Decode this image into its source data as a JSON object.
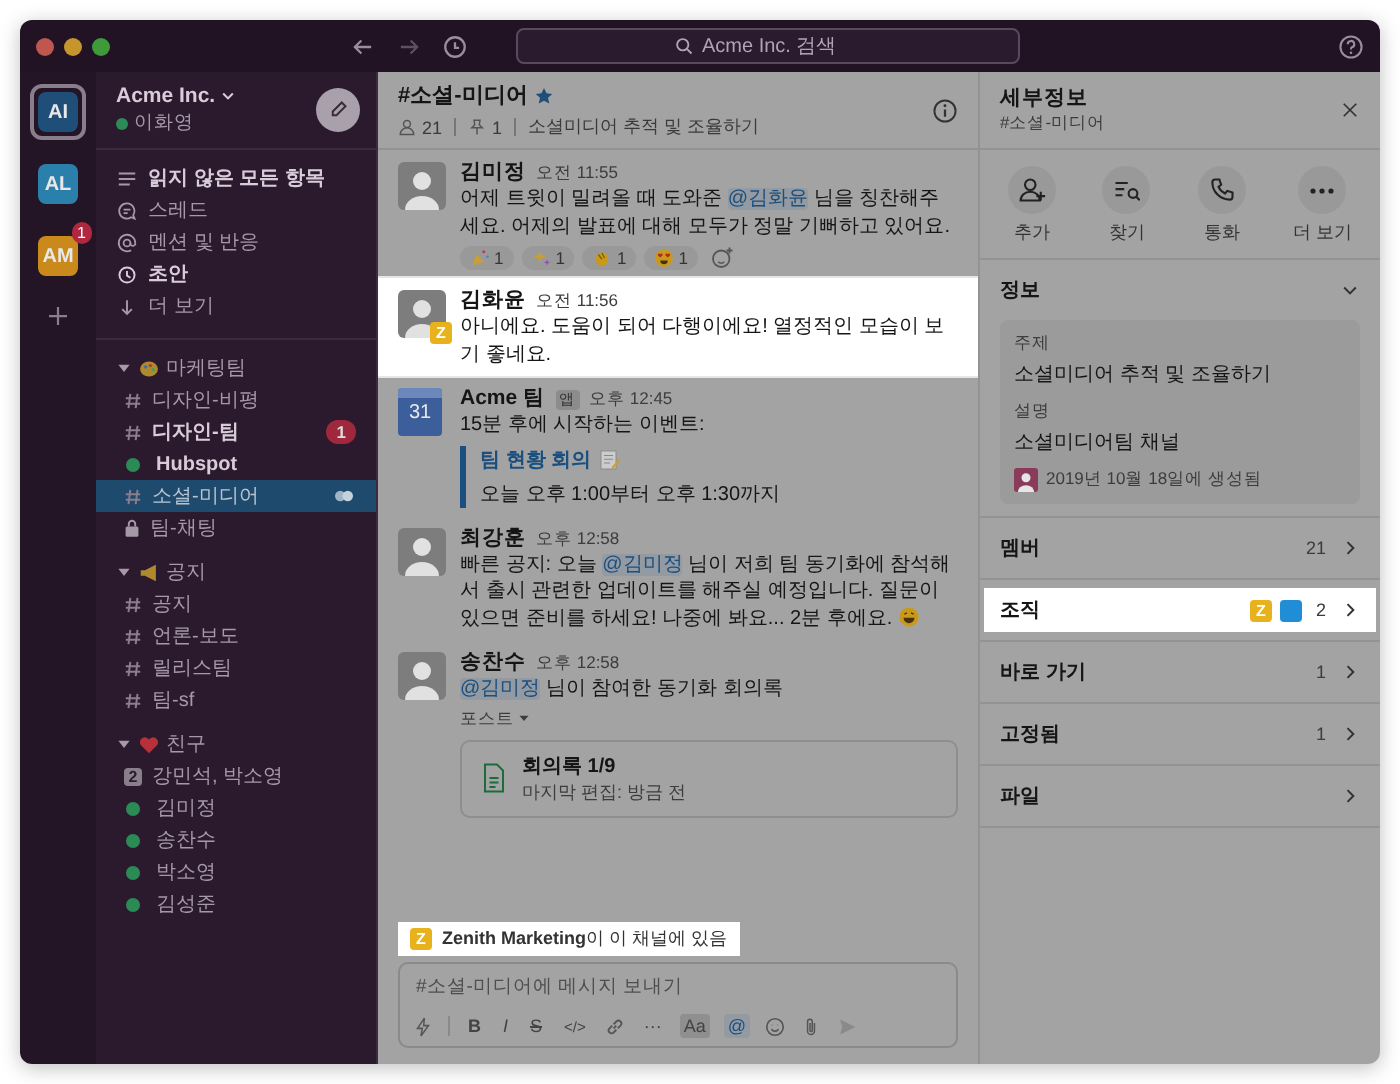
{
  "titlebar": {
    "search": {
      "placeholder": "Acme Inc. 검색"
    }
  },
  "workspaces": [
    {
      "initials": "AI",
      "color": "#1f4e79",
      "selected": true
    },
    {
      "initials": "AL",
      "color": "#2b7fab",
      "selected": false
    },
    {
      "initials": "AM",
      "color": "#c98a1b",
      "selected": false,
      "badge": "1"
    }
  ],
  "sidebar": {
    "workspace": "Acme Inc.",
    "user": "이화영",
    "nav": [
      {
        "kind": "unread",
        "label": "읽지 않은 모든 항목",
        "bold": true
      },
      {
        "kind": "threads",
        "label": "스레드",
        "bold": false
      },
      {
        "kind": "mentions",
        "label": "멘션 및 반응",
        "bold": false
      },
      {
        "kind": "drafts",
        "label": "초안",
        "bold": true
      },
      {
        "kind": "more",
        "label": "더 보기",
        "bold": false
      }
    ],
    "sections": [
      {
        "kind": "palette",
        "title": "마케팅팀",
        "expanded": true,
        "items": [
          {
            "kind": "channel",
            "label": "디자인-비평",
            "bold": false,
            "selected": false
          },
          {
            "kind": "channel",
            "label": "디자인-팀",
            "bold": true,
            "selected": false,
            "badge": "1"
          },
          {
            "kind": "app",
            "label": "Hubspot",
            "bold": true,
            "selected": false
          },
          {
            "kind": "channel",
            "label": "소셜-미디어",
            "bold": false,
            "selected": true,
            "shared": true
          },
          {
            "kind": "private",
            "label": "팀-채팅",
            "bold": false,
            "selected": false
          }
        ]
      },
      {
        "kind": "megaphone",
        "title": "공지",
        "expanded": true,
        "items": [
          {
            "kind": "channel",
            "label": "공지",
            "bold": false,
            "selected": false
          },
          {
            "kind": "channel",
            "label": "언론-보도",
            "bold": false,
            "selected": false
          },
          {
            "kind": "channel",
            "label": "릴리스팀",
            "bold": false,
            "selected": false
          },
          {
            "kind": "channel",
            "label": "팀-sf",
            "bold": false,
            "selected": false
          }
        ]
      },
      {
        "kind": "heart",
        "title": "친구",
        "expanded": true,
        "items": [
          {
            "kind": "group",
            "count": "2",
            "label": "강민석, 박소영",
            "bold": false,
            "selected": false
          },
          {
            "kind": "dm",
            "label": "김미정",
            "bold": false,
            "selected": false
          },
          {
            "kind": "dm",
            "label": "송찬수",
            "bold": false,
            "selected": false
          },
          {
            "kind": "dm",
            "label": "박소영",
            "bold": false,
            "selected": false
          },
          {
            "kind": "dm",
            "label": "김성준",
            "bold": false,
            "selected": false
          }
        ]
      }
    ]
  },
  "channel": {
    "name": "#소셜-미디어",
    "starred": true,
    "members": "21",
    "pins": "1",
    "topic": "소셜미디어 추적 및 조율하기"
  },
  "messages": [
    {
      "kind": "message",
      "author": "김미정",
      "time": "오전 11:55",
      "highlighted": false,
      "segments": [
        {
          "kind": "text",
          "text": "어제 트윗이 밀려올 때 도와준 "
        },
        {
          "kind": "mention",
          "text": "@김화윤"
        },
        {
          "kind": "text",
          "text": " 님을 칭찬해주세요. 어제의 발표에 대해 모두가 정말 기뻐하고 있어요."
        }
      ],
      "reactions": [
        {
          "kind": "party",
          "count": "1"
        },
        {
          "kind": "sparkles",
          "count": "1"
        },
        {
          "kind": "clap",
          "count": "1"
        },
        {
          "kind": "heart-eyes",
          "count": "1"
        }
      ]
    },
    {
      "kind": "message",
      "author": "김화윤",
      "time": "오전 11:56",
      "highlighted": true,
      "org_badge": "Z",
      "segments": [
        {
          "kind": "text",
          "text": "아니에요. 도움이 되어 다행이에요! 열정적인 모습이 보기 좋네요."
        }
      ]
    },
    {
      "kind": "app",
      "author": "Acme 팀",
      "app_tag": "앱",
      "time": "오후 12:45",
      "highlighted": false,
      "calendar_day": "31",
      "segments": [
        {
          "kind": "text",
          "text": "15분 후에 시작하는 이벤트:"
        }
      ],
      "event": {
        "title": "팀 현황 회의",
        "time": "오늘 오후 1:00부터 오후 1:30까지"
      }
    },
    {
      "kind": "message",
      "author": "최강훈",
      "time": "오후 12:58",
      "highlighted": false,
      "segments": [
        {
          "kind": "text",
          "text": "빠른 공지: 오늘 "
        },
        {
          "kind": "mention",
          "text": "@김미정"
        },
        {
          "kind": "text",
          "text": " 님이 저희 팀 동기화에 참석해서 출시 관련한 업데이트를 해주실 예정입니다. 질문이 있으면 준비를 하세요! 나중에 봐요... 2분 후에요. "
        },
        {
          "kind": "emoji"
        }
      ]
    },
    {
      "kind": "post",
      "author": "송찬수",
      "time": "오후 12:58",
      "highlighted": false,
      "segments": [
        {
          "kind": "mention",
          "text": "@김미정"
        },
        {
          "kind": "text",
          "text": " 님이 참여한 동기화 회의록"
        }
      ],
      "post_label": "포스트",
      "file": {
        "title": "회의록 1/9",
        "subtitle": "마지막 편집: 방금 전"
      }
    }
  ],
  "banner": {
    "highlighted": true,
    "badge": "Z",
    "text": "**Zenith Marketing**이 이 채널에 있음"
  },
  "composer": {
    "placeholder": "#소셜-미디어에 메시지 보내기",
    "tools": [
      {
        "kind": "shortcuts"
      },
      {
        "kind": "bold",
        "label": "B"
      },
      {
        "kind": "italic",
        "label": "I"
      },
      {
        "kind": "strike",
        "label": "S"
      },
      {
        "kind": "code",
        "label": "</>"
      },
      {
        "kind": "link"
      },
      {
        "kind": "more",
        "label": "···"
      },
      {
        "kind": "format",
        "label": "Aa",
        "selected": true
      },
      {
        "kind": "mention",
        "label": "@"
      },
      {
        "kind": "emoji"
      },
      {
        "kind": "attach"
      },
      {
        "kind": "send"
      }
    ]
  },
  "details": {
    "title": "세부정보",
    "subtitle": "#소셜-미디어",
    "actions": [
      {
        "kind": "add-person",
        "label": "추가"
      },
      {
        "kind": "find",
        "label": "찾기"
      },
      {
        "kind": "call",
        "label": "통화"
      },
      {
        "kind": "more",
        "label": "더 보기"
      }
    ],
    "info": {
      "title": "정보",
      "expanded": true,
      "fields": [
        {
          "label": "주제",
          "value": "소셜미디어 추적 및 조율하기"
        },
        {
          "label": "설명",
          "value": "소셜미디어팀 채널"
        }
      ],
      "created": "2019년 10월 18일에 생성됨"
    },
    "rows": [
      {
        "label": "멤버",
        "count": "21",
        "highlighted": false
      },
      {
        "label": "조직",
        "count": "2",
        "highlighted": true,
        "org_badges": [
          {
            "label": "Z",
            "color": "#e8b21c"
          },
          {
            "color": "#1f8ed6"
          }
        ]
      },
      {
        "label": "바로 가기",
        "count": "1",
        "highlighted": false
      },
      {
        "label": "고정됨",
        "count": "1",
        "highlighted": false
      },
      {
        "label": "파일",
        "highlighted": false
      }
    ]
  }
}
